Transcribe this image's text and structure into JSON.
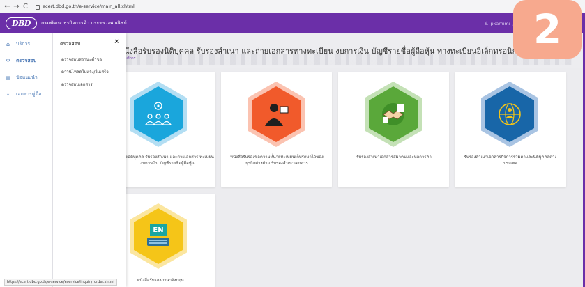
{
  "browser": {
    "url": "ecert.dbd.go.th/e-service/main_all.xhtml",
    "back": "←",
    "forward": "→",
    "reload": "C"
  },
  "header": {
    "logo": "DBD",
    "title": "กรมพัฒนาธุรกิจการค้า กระทรวงพาณิชย์",
    "user": "pkamimi (dbd)"
  },
  "page": {
    "title": "นังสือรับรองนิติบุคคล รับรองสำเนา และถ่ายเอกสารทางทะเบียน งบการเงิน บัญชีรายชื่อผู้ถือหุ้น ทางทะเบียนอิเล็กทรอนิกส์",
    "subtitle": "บริการ"
  },
  "sidebar": {
    "items": [
      {
        "label": "บริการ",
        "icon": "home-icon"
      },
      {
        "label": "ตรวจสอบ",
        "icon": "search-icon"
      },
      {
        "label": "ข้อแนะนำ",
        "icon": "document-icon"
      },
      {
        "label": "เอกสารคู่มือ",
        "icon": "download-icon"
      }
    ]
  },
  "flyout": {
    "title": "ตรวจสอบ",
    "close": "×",
    "items": [
      "ตรวจสอบสถานะคำขอ",
      "ดาวน์โหลดใบแจ้ง/ใบเสร็จ",
      "ตรวจสอบเอกสาร"
    ]
  },
  "cards": [
    {
      "label": "รองนิติบุคคล รับรองสำเนา และถ่ายเอกสาร ทะเบียน งบการเงิน บัญชีรายชื่อผู้ถือหุ้น",
      "color": "#1aa6dc",
      "icon": "people-location-icon"
    },
    {
      "label": "หนังสือรับรองข้อความที่นายทะเบียนเก็บรักษาไว้ของธุรกิจต่างด้าว รับรองสำเนาเอกสาร",
      "color": "#f15a2b",
      "icon": "business-person-icon"
    },
    {
      "label": "รับรองสำเนาเอกสารสมาคมและหอการค้า",
      "color": "#5aa83a",
      "icon": "handshake-icon"
    },
    {
      "label": "รับรองสำเนาเอกสารกิจการร่วมค้าและนิติบุคคลต่างประเทศ",
      "color": "#1866a8",
      "icon": "globe-people-icon"
    },
    {
      "label": "หนังสือรับรองภาษาอังกฤษ",
      "color": "#f5c518",
      "icon": "english-document-icon",
      "badge": "EN"
    }
  ],
  "status_url": "https://ecert.dbd.go.th/e-service/eservice/inquiry_order.xhtml",
  "step_badge": "2",
  "colors": {
    "primary": "#6b2fa8",
    "badge": "#f7a98e"
  }
}
